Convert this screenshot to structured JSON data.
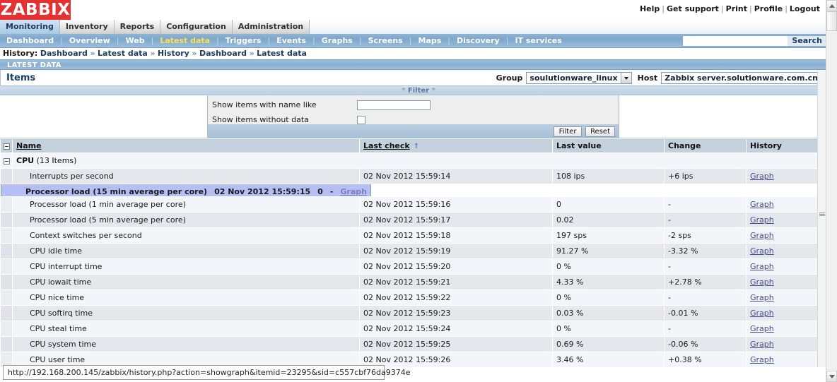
{
  "brand": {
    "logo_text": "ZABBIX",
    "logo_color": "#e83030"
  },
  "top_links": [
    "Help",
    "Get support",
    "Print",
    "Profile",
    "Logout"
  ],
  "main_menu": [
    {
      "label": "Monitoring",
      "active": true
    },
    {
      "label": "Inventory",
      "active": false
    },
    {
      "label": "Reports",
      "active": false
    },
    {
      "label": "Configuration",
      "active": false
    },
    {
      "label": "Administration",
      "active": false
    }
  ],
  "sub_menu": [
    {
      "label": "Dashboard",
      "active": false
    },
    {
      "label": "Overview",
      "active": false
    },
    {
      "label": "Web",
      "active": false
    },
    {
      "label": "Latest data",
      "active": true
    },
    {
      "label": "Triggers",
      "active": false
    },
    {
      "label": "Events",
      "active": false
    },
    {
      "label": "Graphs",
      "active": false
    },
    {
      "label": "Screens",
      "active": false
    },
    {
      "label": "Maps",
      "active": false
    },
    {
      "label": "Discovery",
      "active": false
    },
    {
      "label": "IT services",
      "active": false
    }
  ],
  "search": {
    "value": "",
    "placeholder": "",
    "button_label": "Search"
  },
  "history": {
    "label": "History:",
    "separator": "»",
    "items": [
      "Dashboard",
      "Latest data",
      "History",
      "Dashboard",
      "Latest data"
    ]
  },
  "page_header": {
    "title": "LATEST DATA",
    "fullscreen_icon": "fullscreen-icon"
  },
  "items_header": {
    "title": "Items",
    "group_label": "Group",
    "group_value": "soulutionware_linux",
    "host_label": "Host",
    "host_value": "Zabbix server.solutionware.com.cn"
  },
  "filter": {
    "bar_label": "Filter",
    "bar_star": "*",
    "name_like_label": "Show items with name like",
    "name_like_value": "",
    "without_data_label": "Show items without data",
    "without_data_checked": false,
    "apply_label": "Filter",
    "reset_label": "Reset"
  },
  "table": {
    "columns": [
      "Name",
      "Last check",
      "Last value",
      "Change",
      "History"
    ],
    "sort_column": "Last check",
    "sort_arrow": "↑",
    "group": {
      "name": "CPU",
      "count": "(13 Items)"
    },
    "rows": [
      {
        "name": "Interrupts per second",
        "last_check": "02 Nov 2012 15:59:14",
        "last_value": "108 ips",
        "change": "+6 ips",
        "history": "Graph",
        "selected": false
      },
      {
        "name": "Processor load (15 min average per core)",
        "last_check": "02 Nov 2012 15:59:15",
        "last_value": "0",
        "change": "-",
        "history": "Graph",
        "selected": true
      },
      {
        "name": "Processor load (1 min average per core)",
        "last_check": "02 Nov 2012 15:59:16",
        "last_value": "0",
        "change": "-",
        "history": "Graph",
        "selected": false
      },
      {
        "name": "Processor load (5 min average per core)",
        "last_check": "02 Nov 2012 15:59:17",
        "last_value": "0.02",
        "change": "-",
        "history": "Graph",
        "selected": false
      },
      {
        "name": "Context switches per second",
        "last_check": "02 Nov 2012 15:59:18",
        "last_value": "197 sps",
        "change": "-2 sps",
        "history": "Graph",
        "selected": false
      },
      {
        "name": "CPU idle time",
        "last_check": "02 Nov 2012 15:59:19",
        "last_value": "91.27 %",
        "change": "-3.32 %",
        "history": "Graph",
        "selected": false
      },
      {
        "name": "CPU interrupt time",
        "last_check": "02 Nov 2012 15:59:20",
        "last_value": "0 %",
        "change": "-",
        "history": "Graph",
        "selected": false
      },
      {
        "name": "CPU iowait time",
        "last_check": "02 Nov 2012 15:59:21",
        "last_value": "4.33 %",
        "change": "+2.78 %",
        "history": "Graph",
        "selected": false
      },
      {
        "name": "CPU nice time",
        "last_check": "02 Nov 2012 15:59:22",
        "last_value": "0 %",
        "change": "-",
        "history": "Graph",
        "selected": false
      },
      {
        "name": "CPU softirq time",
        "last_check": "02 Nov 2012 15:59:23",
        "last_value": "0.03 %",
        "change": "-0.01 %",
        "history": "Graph",
        "selected": false
      },
      {
        "name": "CPU steal time",
        "last_check": "02 Nov 2012 15:59:24",
        "last_value": "0 %",
        "change": "-",
        "history": "Graph",
        "selected": false
      },
      {
        "name": "CPU system time",
        "last_check": "02 Nov 2012 15:59:25",
        "last_value": "0.69 %",
        "change": "-0.06 %",
        "history": "Graph",
        "selected": false
      },
      {
        "name": "CPU user time",
        "last_check": "02 Nov 2012 15:59:26",
        "last_value": "3.46 %",
        "change": "+0.38 %",
        "history": "Graph",
        "selected": false
      }
    ]
  },
  "status_bar": {
    "url": "http://192.168.200.145/zabbix/history.php?action=showgraph&itemid=23295&sid=c557cbf76da9374e"
  }
}
